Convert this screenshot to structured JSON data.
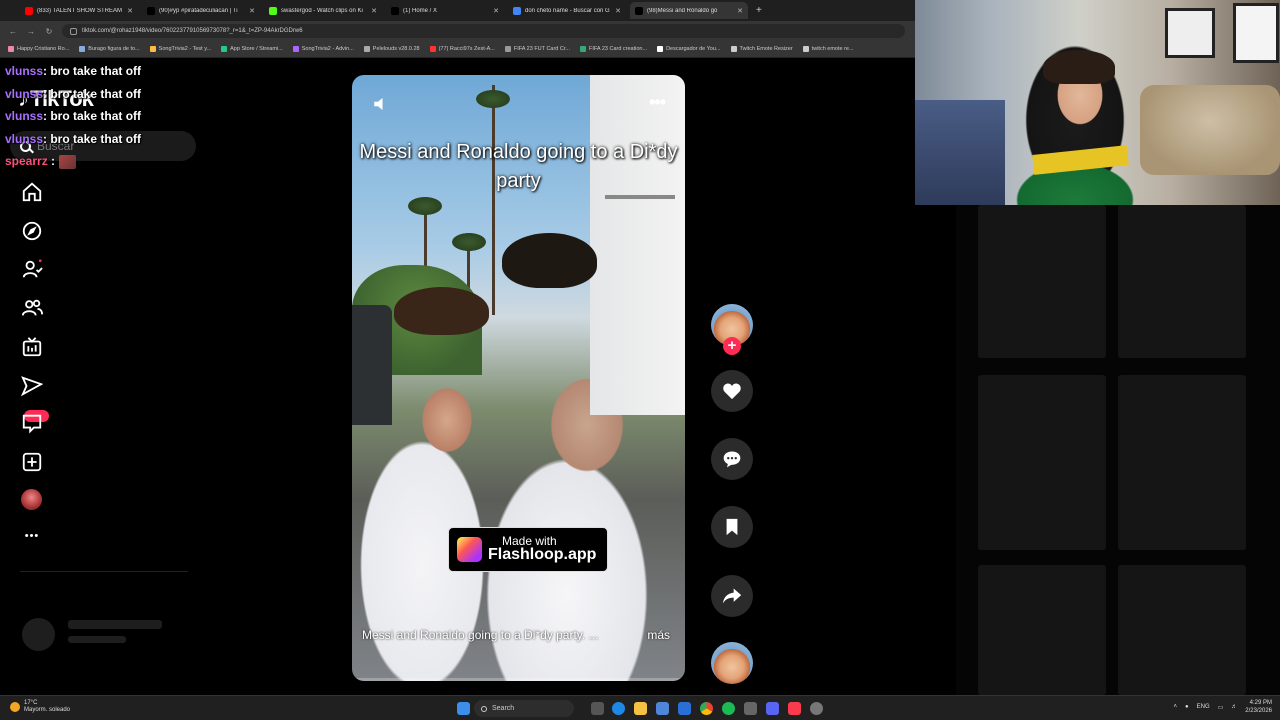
{
  "browser": {
    "tabs": [
      {
        "title": "(833) TALENT SHOW STREAM",
        "favicon_color": "#ff0000",
        "active": false
      },
      {
        "title": "(90)#yp #piratadeculiacan | Ti",
        "favicon_color": "#000000",
        "active": false
      },
      {
        "title": "swastergod - Watch clips on Ki",
        "favicon_color": "#53fc18",
        "active": false
      },
      {
        "title": "(1) Home / X",
        "favicon_color": "#000000",
        "active": false
      },
      {
        "title": "don cheto name - Buscar con G",
        "favicon_color": "#4285f4",
        "active": false
      },
      {
        "title": "(98)Messi and Ronaldo go",
        "favicon_color": "#000000",
        "active": true
      }
    ],
    "new_tab_label": "+",
    "url": "tiktok.com/@rohaz1948/video/7602237791056973078?_r=1&_t=ZP-94AkrDGDrw6",
    "bookmarks": [
      {
        "label": "Happy Cristiano Ro...",
        "color": "#e8a"
      },
      {
        "label": "Burago figura de to...",
        "color": "#8ad"
      },
      {
        "label": "SongTrivia2 - Test y...",
        "color": "#fb4"
      },
      {
        "label": "App Store / Streami...",
        "color": "#2c8"
      },
      {
        "label": "SongTrivia2 - Advin...",
        "color": "#a6f"
      },
      {
        "label": "Pelelouds v28.0.28",
        "color": "#aaa"
      },
      {
        "label": "(77) Racci97s Zest-A...",
        "color": "#f33"
      },
      {
        "label": "FIFA 23 FUT Card Cr...",
        "color": "#999"
      },
      {
        "label": "FIFA 23 Card creation...",
        "color": "#3a7"
      },
      {
        "label": "Descargador de You...",
        "color": "#fff"
      },
      {
        "label": "Twitch Emote Resizer",
        "color": "#ccc"
      },
      {
        "label": "twitch emote re...",
        "color": "#ccc"
      }
    ]
  },
  "chat": [
    {
      "user": "vlunss",
      "message": ": bro take that off"
    },
    {
      "user": "vlunss",
      "message": ": bro take that off"
    },
    {
      "user": "vlunss",
      "message": ": bro take that off"
    },
    {
      "user": "vlunss",
      "message": ": bro take that off"
    },
    {
      "user": "spearrz",
      "message": " :"
    }
  ],
  "tiktok": {
    "logo": "TikTok",
    "search_placeholder": "Buscar",
    "nav_icons": [
      "home-icon",
      "explore-icon",
      "following-icon",
      "friends-icon",
      "live-icon",
      "messages-icon",
      "inbox-icon",
      "upload-icon",
      "profile-icon",
      "more-icon"
    ],
    "more_glyph": "•••",
    "video": {
      "overlay_title": "Messi and Ronaldo going to a Di*dy party",
      "caption": "Messi and Ronaldo going to a Di*dy party. ...",
      "more_label": "más",
      "watermark_made": "Made with",
      "watermark_brand": "Flashloop.app",
      "progress": 0.0
    },
    "actions": [
      "creator-avatar",
      "like",
      "comment",
      "bookmark",
      "share",
      "sound"
    ],
    "follow_plus": "+"
  },
  "taskbar": {
    "weather_temp": "17°C",
    "weather_desc": "Mayorm. soleado",
    "search_label": "Search",
    "lang": "ENG",
    "time": "4:29 PM",
    "date": "2/23/2026"
  }
}
